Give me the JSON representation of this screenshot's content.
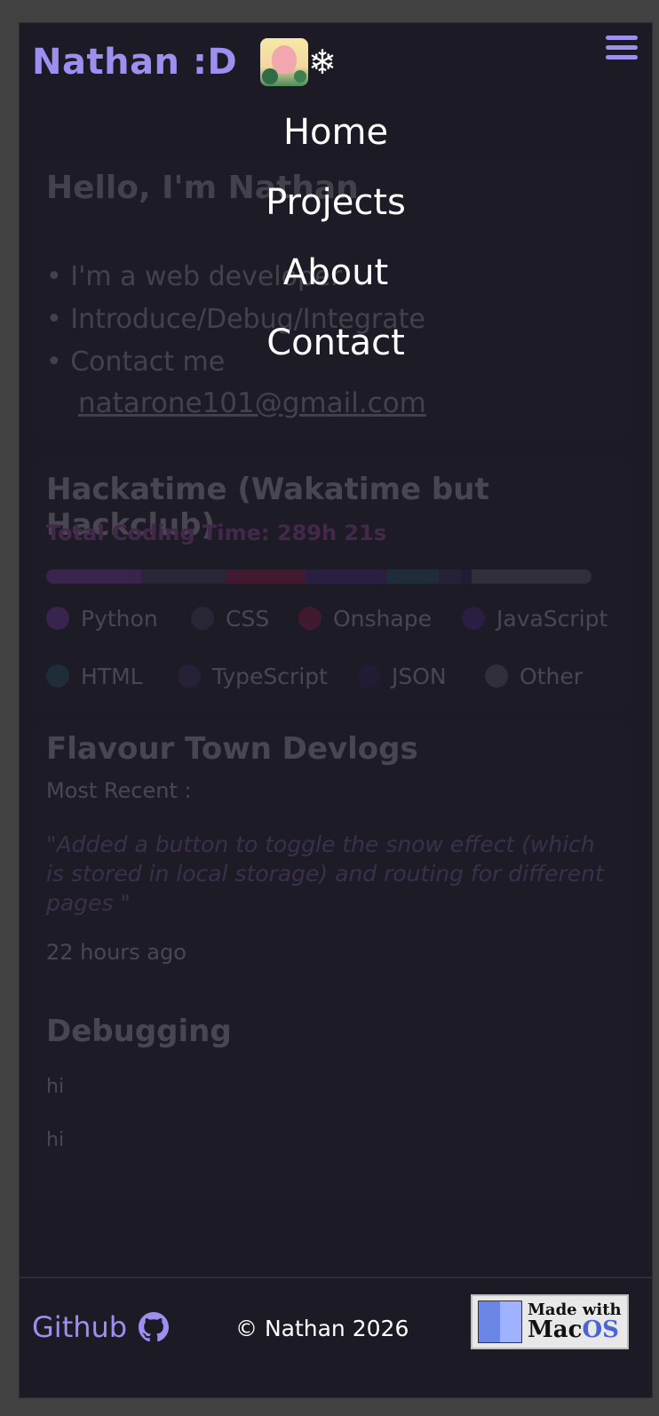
{
  "header": {
    "brand": "Nathan :D",
    "snow_glyph": "❄"
  },
  "nav": {
    "items": [
      "Home",
      "Projects",
      "About",
      "Contact"
    ]
  },
  "intro": {
    "title": "Hello, I'm Nathan",
    "bullets": [
      "I'm a web developer",
      "Introduce/Debug/Integrate",
      "Contact me"
    ],
    "email": "natarone101@gmail.com"
  },
  "hackatime": {
    "title": "Hackatime (Wakatime but Hackclub)",
    "total_label": "Total Coding Time: 289h 21s",
    "languages": [
      {
        "name": "Python",
        "color": "#9b4ad6",
        "fraction": 0.175
      },
      {
        "name": "CSS",
        "color": "#53507a",
        "fraction": 0.155
      },
      {
        "name": "Onshape",
        "color": "#c81e57",
        "fraction": 0.145
      },
      {
        "name": "JavaScript",
        "color": "#5b2ca8",
        "fraction": 0.15
      },
      {
        "name": "HTML",
        "color": "#2b6d86",
        "fraction": 0.095
      },
      {
        "name": "TypeScript",
        "color": "#4a3a72",
        "fraction": 0.04
      },
      {
        "name": "JSON",
        "color": "#3d1e6b",
        "fraction": 0.02
      },
      {
        "name": "Other",
        "color": "#7c7c88",
        "fraction": 0.22
      }
    ]
  },
  "devlogs": {
    "title": "Flavour Town Devlogs",
    "subtitle": "Most Recent :",
    "quote": "\"Added a button to toggle the snow effect (which is stored in local storage) and routing for different pages \"",
    "time": "22 hours ago"
  },
  "debugging": {
    "title": "Debugging",
    "lines": [
      "hi",
      "hi"
    ]
  },
  "footer": {
    "github": "Github",
    "copyright": "© Nathan 2026",
    "badge_line1": "Made with",
    "badge_mac": "Mac",
    "badge_os": "OS"
  }
}
